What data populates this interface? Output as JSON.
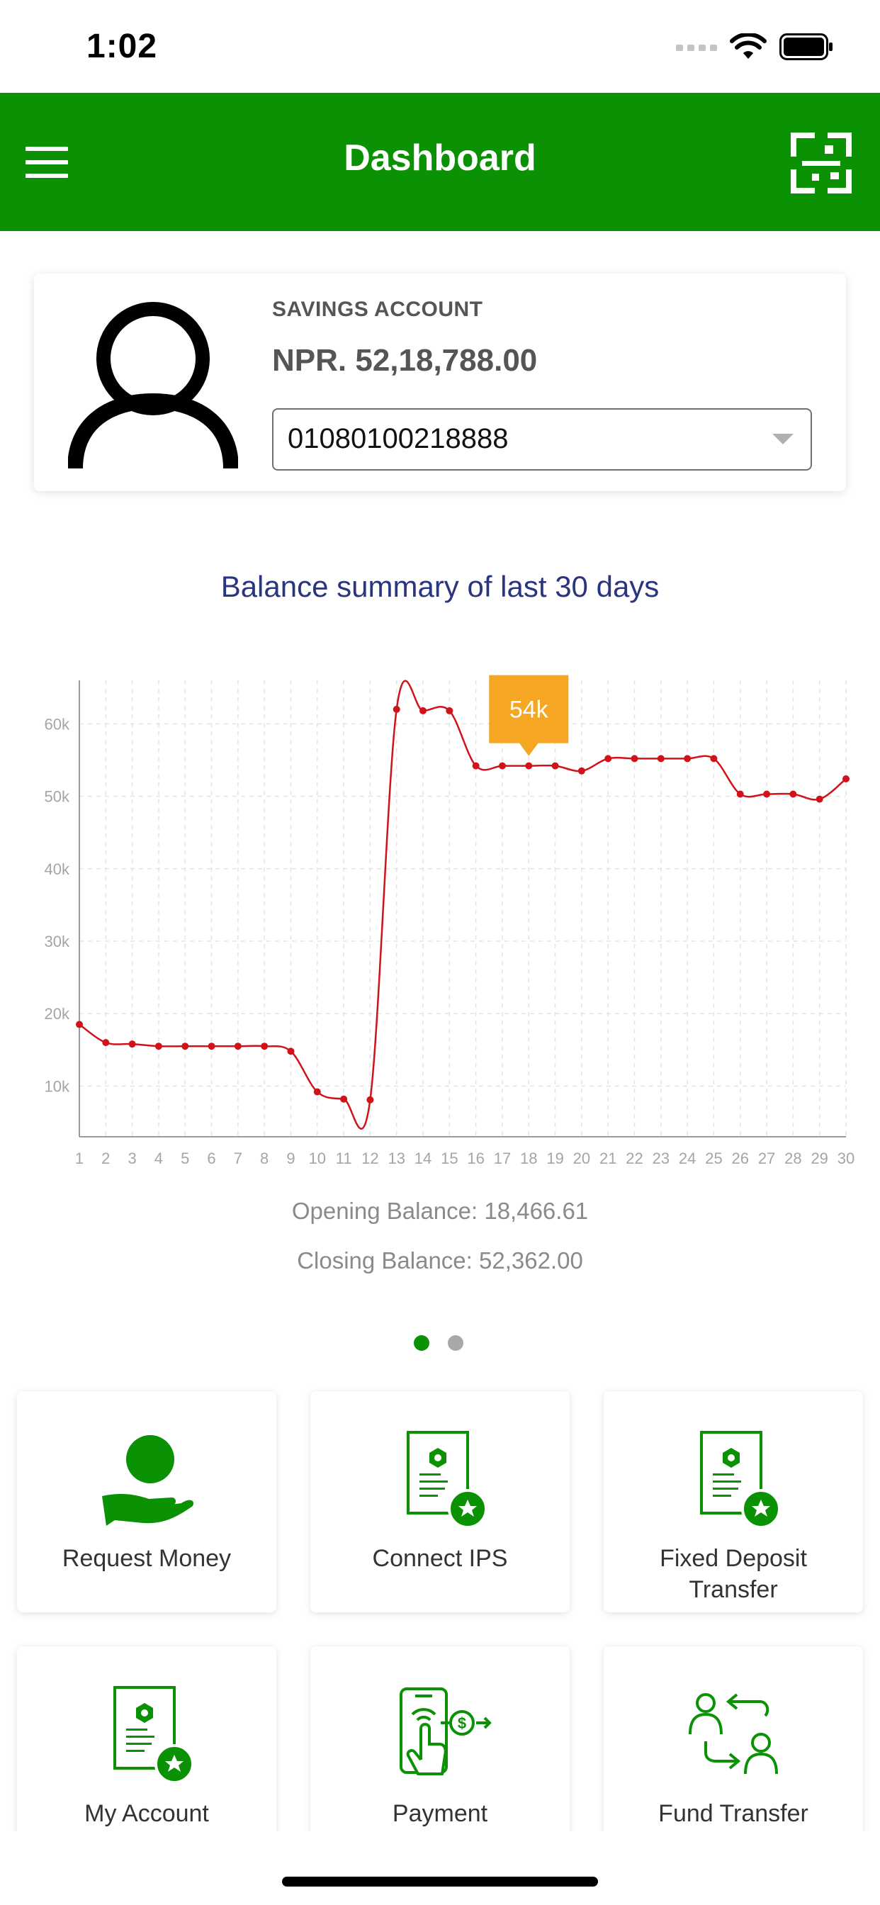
{
  "status_bar": {
    "time": "1:02"
  },
  "header": {
    "title": "Dashboard",
    "menu_icon": "hamburger-menu-icon",
    "scan_icon": "qr-scan-icon"
  },
  "account": {
    "type": "SAVINGS ACCOUNT",
    "balance": "NPR. 52,18,788.00",
    "number": "01080100218888"
  },
  "chart_data": {
    "type": "line",
    "title": "Balance summary of last 30 days",
    "x": [
      1,
      2,
      3,
      4,
      5,
      6,
      7,
      8,
      9,
      10,
      11,
      12,
      13,
      14,
      15,
      16,
      17,
      18,
      19,
      20,
      21,
      22,
      23,
      24,
      25,
      26,
      27,
      28,
      29,
      30
    ],
    "values": [
      18500,
      16000,
      15800,
      15500,
      15500,
      15500,
      15500,
      15500,
      14800,
      9200,
      8200,
      8100,
      62000,
      61800,
      61800,
      54200,
      54200,
      54200,
      54200,
      53500,
      55200,
      55200,
      55200,
      55200,
      55200,
      50300,
      50300,
      50300,
      49600,
      52400
    ],
    "y_ticks": [
      "10k",
      "20k",
      "30k",
      "40k",
      "50k",
      "60k"
    ],
    "ylim": [
      3000,
      66000
    ],
    "grid": true,
    "tooltip": {
      "x": 18,
      "label": "54k"
    },
    "line_color": "#d0121b",
    "tooltip_color": "#f5a623"
  },
  "summary": {
    "opening": "Opening Balance: 18,466.61",
    "closing": "Closing Balance: 52,362.00"
  },
  "tiles": [
    {
      "label": "Request Money",
      "icon": "request-money-icon"
    },
    {
      "label": "Connect IPS",
      "icon": "certificate-icon"
    },
    {
      "label_line1": "Fixed Deposit",
      "label_line2": "Transfer",
      "icon": "certificate-icon"
    },
    {
      "label": "My Account",
      "icon": "certificate-icon"
    },
    {
      "label": "Payment",
      "icon": "mobile-payment-icon"
    },
    {
      "label": "Fund Transfer",
      "icon": "fund-transfer-icon"
    }
  ],
  "colors": {
    "brand_green": "#0b9104",
    "title_blue": "#2a357f"
  }
}
